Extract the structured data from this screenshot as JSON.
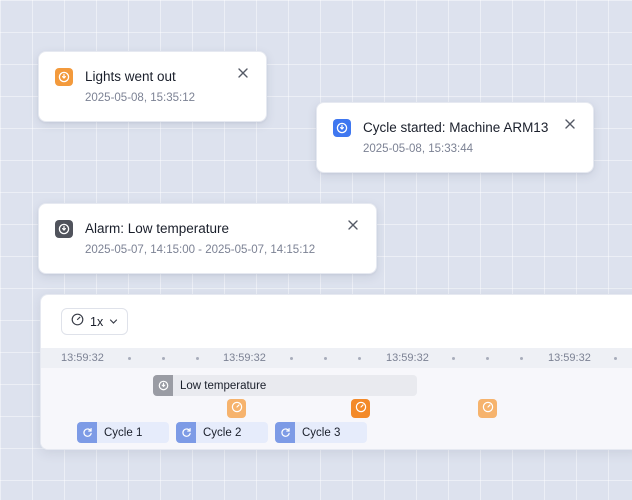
{
  "notifications": [
    {
      "title": "Lights went out",
      "time": "2025-05-08, 15:35:12",
      "icon": "info-icon",
      "color": "#f39a3c"
    },
    {
      "title": "Cycle started: Machine ARM13",
      "time": "2025-05-08, 15:33:44",
      "icon": "info-icon",
      "color": "#3f77f0"
    },
    {
      "title": "Alarm: Low temperature",
      "time": "2025-05-07, 14:15:00 - 2025-05-07, 14:15:12",
      "icon": "info-icon",
      "color": "#50535c"
    }
  ],
  "timeline": {
    "speed": "1x",
    "ticks": [
      "13:59:32",
      "13:59:32",
      "13:59:32",
      "13:59:32"
    ],
    "alarm_bar": {
      "label": "Low temperature",
      "icon": "info-icon"
    },
    "cycles": [
      {
        "label": "Cycle 1",
        "icon": "refresh-icon"
      },
      {
        "label": "Cycle 2",
        "icon": "refresh-icon"
      },
      {
        "label": "Cycle 3",
        "icon": "refresh-icon"
      }
    ],
    "markers": [
      {
        "icon": "gauge-icon",
        "color": "#f6b36d"
      },
      {
        "icon": "gauge-icon",
        "color": "#f38a2a"
      },
      {
        "icon": "gauge-icon",
        "color": "#f6b36d"
      }
    ]
  },
  "colors": {
    "background": "#dde2ee",
    "accent_blue": "#3f77f0",
    "accent_orange": "#f39a3c"
  }
}
